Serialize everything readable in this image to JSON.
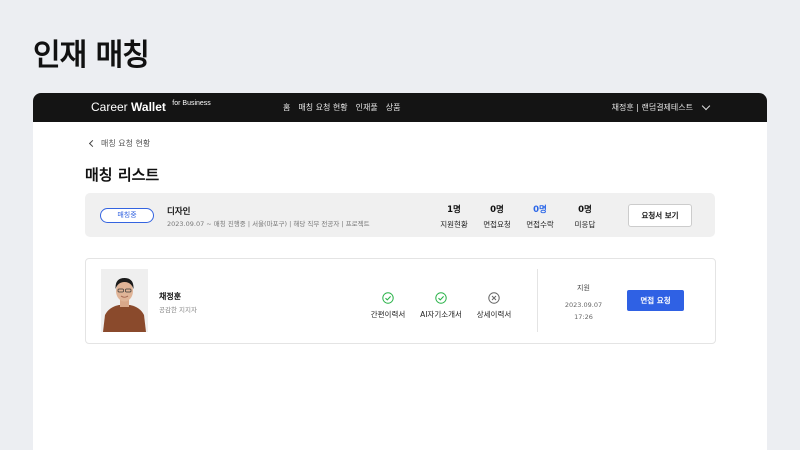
{
  "slide": {
    "title": "인재 매칭"
  },
  "header": {
    "logo_text": "Career",
    "logo_bold": "Wallet",
    "logo_sup": "for Business",
    "nav": [
      "홈",
      "매칭 요청 현황",
      "인재풀",
      "상품"
    ],
    "user": "채정훈 | 랜덤결제테스트"
  },
  "breadcrumb": {
    "back_label": "매칭 요청 현황"
  },
  "page_title": "매칭 리스트",
  "summary": {
    "status": "매칭중",
    "job_title": "디자인",
    "job_info": "2023.09.07 ~ 매칭 진행중 | 서울(마포구) | 해당 직무 전공자 | 프로젝트",
    "stats": [
      {
        "value": "1명",
        "label": "지원현황",
        "highlight": false
      },
      {
        "value": "0명",
        "label": "면접요청",
        "highlight": false
      },
      {
        "value": "0명",
        "label": "면접수락",
        "highlight": true
      },
      {
        "value": "0명",
        "label": "미응답",
        "highlight": false
      }
    ],
    "report_button": "요청서 보기"
  },
  "candidate": {
    "name": "채정훈",
    "tagline": "공감한 지지자",
    "docs": [
      {
        "label": "간편이력서",
        "status": "check"
      },
      {
        "label": "AI자기소개서",
        "status": "check"
      },
      {
        "label": "상세이력서",
        "status": "x"
      }
    ],
    "apply_label": "지원",
    "apply_date": "2023.09.07",
    "apply_time": "17:26",
    "interview_button": "면접 요청"
  },
  "colors": {
    "accent": "#2f61e4",
    "check": "#2bb34a",
    "topbar": "#141414"
  }
}
